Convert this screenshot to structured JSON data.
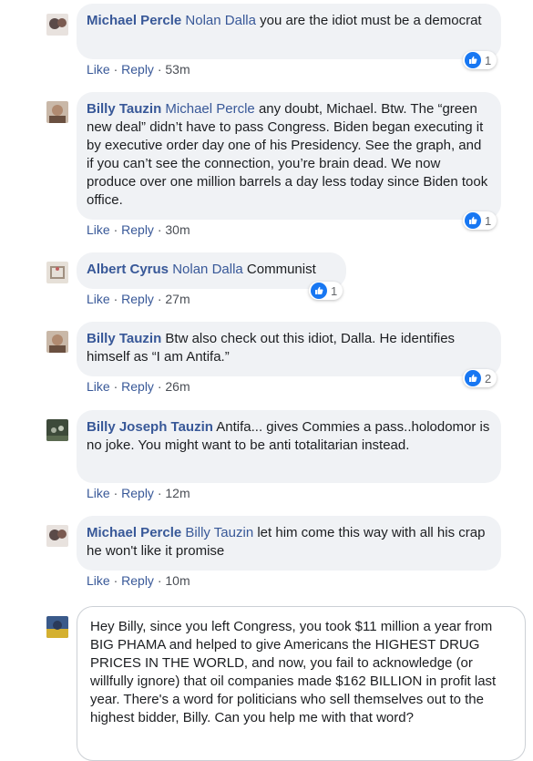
{
  "comments": [
    {
      "author": "Michael Percle",
      "mention": "Nolan Dalla",
      "text": " you are the idiot must be a democrat",
      "like_label": "Like",
      "reply_label": "Reply",
      "time": "53m",
      "reactions": "1",
      "avatar_color": "#5a4a48"
    },
    {
      "author": "Billy Tauzin",
      "mention": "Michael Percle",
      "text": " any doubt, Michael. Btw. The “green new deal” didn’t have to pass Congress. Biden began executing it by executive order day one of his Presidency. See the graph, and if you can’t see the connection, you’re brain dead. We now produce over one million barrels a day less today since Biden took office.",
      "like_label": "Like",
      "reply_label": "Reply",
      "time": "30m",
      "reactions": "1",
      "avatar_color": "#8a6a55"
    },
    {
      "author": "Albert Cyrus",
      "mention": "Nolan Dalla",
      "text": " Communist",
      "like_label": "Like",
      "reply_label": "Reply",
      "time": "27m",
      "reactions": "1",
      "avatar_color": "#d8d0c8"
    },
    {
      "author": "Billy Tauzin",
      "mention": "",
      "text": " Btw also check out this idiot, Dalla. He identifies himself as “I am Antifa.”",
      "like_label": "Like",
      "reply_label": "Reply",
      "time": "26m",
      "reactions": "2",
      "avatar_color": "#8a6a55"
    },
    {
      "author": "Billy Joseph Tauzin",
      "mention": "",
      "text": " Antifa... gives Commies a pass..holodomor is no joke. You might want to be anti totalitarian instead.",
      "like_label": "Like",
      "reply_label": "Reply",
      "time": "12m",
      "reactions": "",
      "avatar_color": "#3d4a3a"
    },
    {
      "author": "Michael Percle",
      "mention": "Billy Tauzin",
      "text": " let him come this way with all his crap he won't like it promise",
      "like_label": "Like",
      "reply_label": "Reply",
      "time": "10m",
      "reactions": "",
      "avatar_color": "#5a4a48"
    }
  ],
  "draft": {
    "text": "Hey Billy, since you left Congress, you took $11 million a year from BIG PHAMA and helped to give Americans the HIGHEST DRUG PRICES IN THE WORLD, and now, you fail to acknowledge (or willfully ignore) that oil companies made $162 BILLION in profit last year.  There's a word for politicians who sell themselves out to the highest bidder, Billy.  Can you help me with that word?",
    "avatar_color": "#3a5a8a"
  },
  "separator": "·"
}
